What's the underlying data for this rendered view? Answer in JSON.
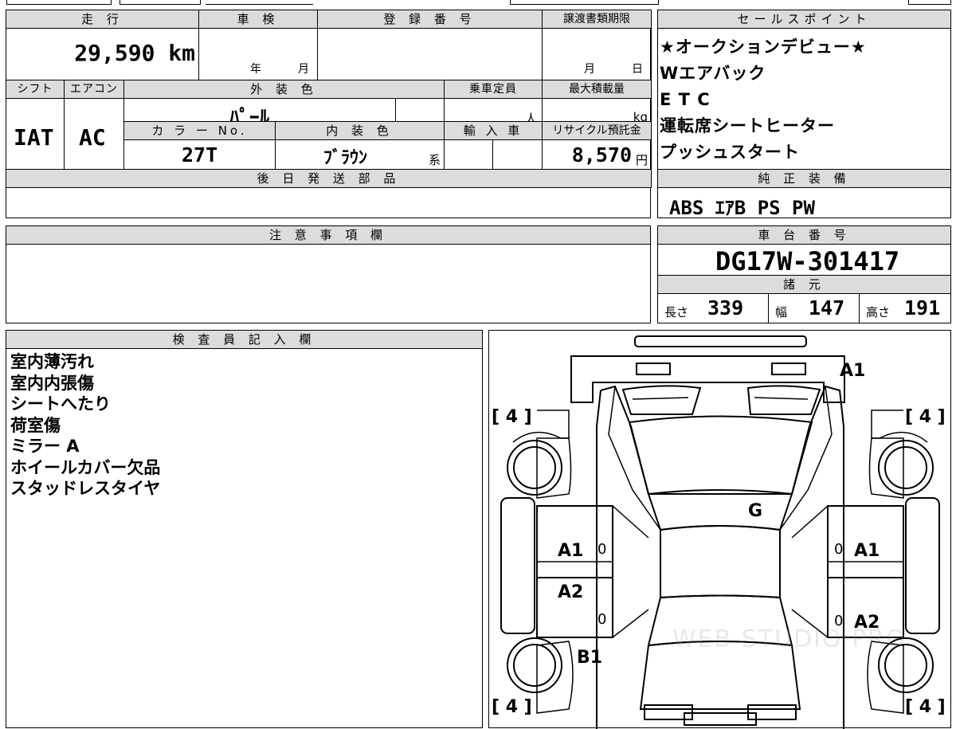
{
  "top": {
    "headers": {
      "mileage": "走 行",
      "shaken": "車 検",
      "reg_no": "登 録 番 号",
      "transfer_deadline": "譲渡書類期限"
    },
    "mileage_value": "29,590 km",
    "shaken_year": "年",
    "shaken_month": "月",
    "deadline_month": "月",
    "deadline_day": "日",
    "shift_hdr": "シフト",
    "aircon_hdr": "エアコン",
    "ext_color_hdr": "外 装 色",
    "capacity_hdr": "乗車定員",
    "max_load_hdr": "最大積載量",
    "shift_value": "IAT",
    "aircon_value": "AC",
    "ext_color_value": "ﾊﾟｰﾙ",
    "capacity_unit": "人",
    "max_load_unit": "kg",
    "color_no_hdr": "カ ラ ー No.",
    "int_color_hdr": "内 装 色",
    "import_hdr": "輸 入 車",
    "recycle_hdr": "リサイクル預託金",
    "color_no_value": "27T",
    "int_color_value": "ﾌﾞﾗｳﾝ",
    "int_color_suffix": "系",
    "recycle_value": "8,570",
    "recycle_unit": "円",
    "later_parts_hdr": "後 日 発 送 部 品"
  },
  "sales_points": {
    "header": "セールスポイント",
    "items": [
      "★オークションデビュー★",
      "Wエアバック",
      "E T C",
      "運転席シートヒーター",
      "プッシュスタート"
    ]
  },
  "genuine_equipment": {
    "header": "純 正 装 備",
    "value": "ABS ｴｱB PS PW"
  },
  "notes": {
    "header": "注 意 事 項 欄"
  },
  "chassis": {
    "header": "車 台 番 号",
    "value": "DG17W-301417"
  },
  "specs": {
    "header": "諸 元",
    "length_label": "長さ",
    "length_value": "339",
    "width_label": "幅",
    "width_value": "147",
    "height_label": "高さ",
    "height_value": "191"
  },
  "inspector": {
    "header": "検 査 員 記 入 欄",
    "lines": [
      "室内薄汚れ",
      "室内内張傷",
      "シートへたり",
      "荷室傷",
      "ミラー A",
      "ホイールカバー欠品",
      "スタッドレスタイヤ"
    ]
  },
  "diagram": {
    "tire_tl": "[ 4 ]",
    "tire_tr": "[ 4 ]",
    "tire_bl": "[ 4 ]",
    "tire_br": "[ 4 ]",
    "marks": {
      "front": "A1",
      "windshield": "G",
      "left_front_door": "A1",
      "left_front_zero": "0",
      "left_rear_door": "A2",
      "left_rear_zero": "0",
      "left_rear_quarter": "B1",
      "right_front_zero": "0",
      "right_front_door": "A1",
      "right_rear_zero": "0",
      "right_rear_door": "A2"
    },
    "watermark": "WEB STUDIO PRO"
  }
}
